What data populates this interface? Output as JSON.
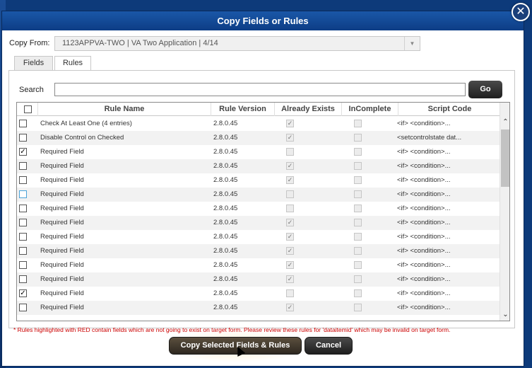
{
  "dialog": {
    "title": "Copy Fields or Rules",
    "close_glyph": "✕"
  },
  "copy_from": {
    "label": "Copy From:",
    "value": "1123APPVA-TWO | VA Two Application | 4/14",
    "arrow_glyph": "▼"
  },
  "tabs": [
    {
      "label": "Fields",
      "active": false
    },
    {
      "label": "Rules",
      "active": true
    }
  ],
  "search": {
    "label": "Search",
    "value": "",
    "go_label": "Go"
  },
  "grid": {
    "columns": [
      "Rule Name",
      "Rule Version",
      "Already Exists",
      "InComplete",
      "Script Code"
    ],
    "rows": [
      {
        "checked": false,
        "name": "Check At Least One (4 entries)",
        "version": "2.8.0.45",
        "already_exists": true,
        "incomplete": false,
        "script": "<if> <condition>..."
      },
      {
        "checked": false,
        "name": "Disable Control on Checked",
        "version": "2.8.0.45",
        "already_exists": true,
        "incomplete": false,
        "script": "<setcontrolstate dat..."
      },
      {
        "checked": true,
        "name": "Required Field",
        "version": "2.8.0.45",
        "already_exists": false,
        "incomplete": false,
        "script": "<if> <condition>..."
      },
      {
        "checked": false,
        "name": "Required Field",
        "version": "2.8.0.45",
        "already_exists": true,
        "incomplete": false,
        "script": "<if> <condition>..."
      },
      {
        "checked": false,
        "name": "Required Field",
        "version": "2.8.0.45",
        "already_exists": true,
        "incomplete": false,
        "script": "<if> <condition>..."
      },
      {
        "checked": false,
        "focus": true,
        "name": "Required Field",
        "version": "2.8.0.45",
        "already_exists": false,
        "incomplete": false,
        "script": "<if> <condition>..."
      },
      {
        "checked": false,
        "name": "Required Field",
        "version": "2.8.0.45",
        "already_exists": false,
        "incomplete": false,
        "script": "<if> <condition>..."
      },
      {
        "checked": false,
        "name": "Required Field",
        "version": "2.8.0.45",
        "already_exists": true,
        "incomplete": false,
        "script": "<if> <condition>..."
      },
      {
        "checked": false,
        "name": "Required Field",
        "version": "2.8.0.45",
        "already_exists": true,
        "incomplete": false,
        "script": "<if> <condition>..."
      },
      {
        "checked": false,
        "name": "Required Field",
        "version": "2.8.0.45",
        "already_exists": true,
        "incomplete": false,
        "script": "<if> <condition>..."
      },
      {
        "checked": false,
        "name": "Required Field",
        "version": "2.8.0.45",
        "already_exists": true,
        "incomplete": false,
        "script": "<if> <condition>..."
      },
      {
        "checked": false,
        "name": "Required Field",
        "version": "2.8.0.45",
        "already_exists": true,
        "incomplete": false,
        "script": "<if> <condition>..."
      },
      {
        "checked": true,
        "name": "Required Field",
        "version": "2.8.0.45",
        "already_exists": false,
        "incomplete": false,
        "script": "<if> <condition>..."
      },
      {
        "checked": false,
        "name": "Required Field",
        "version": "2.8.0.45",
        "already_exists": true,
        "incomplete": false,
        "script": "<if> <condition>..."
      }
    ],
    "scroll_up_glyph": "⌃",
    "scroll_down_glyph": "⌄"
  },
  "footnote": "* Rules highlighted with RED contain fields which are not going to exist on target form. Please review these rules for 'dataitemid' which may be invalid on target form.",
  "buttons": {
    "copy_label": "Copy Selected Fields & Rules",
    "cancel_label": "Cancel"
  },
  "colors": {
    "title_bar": "#0d3d85",
    "footnote": "#cc0000",
    "button_dark": "#2e2820"
  }
}
